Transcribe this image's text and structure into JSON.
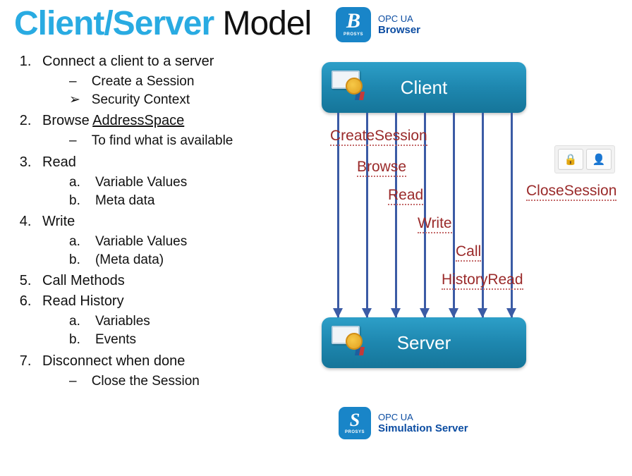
{
  "title": {
    "accent": "Client/Server",
    "plain": "Model"
  },
  "browser_logo": {
    "letter": "B",
    "prosys": "PROSYS",
    "line1": "OPC UA",
    "line2": "Browser"
  },
  "sim_logo": {
    "letter": "S",
    "prosys": "PROSYS",
    "line1": "OPC UA",
    "line2": "Simulation Server"
  },
  "outline": {
    "i1": {
      "text": "Connect a client to a server",
      "sub": [
        "Create a Session",
        "Security Context"
      ]
    },
    "i2": {
      "text_a": "Browse ",
      "text_b": "AddressSpace",
      "sub": [
        "To find what is available"
      ]
    },
    "i3": {
      "text": "Read",
      "sub": [
        "Variable Values",
        "Meta data"
      ]
    },
    "i4": {
      "text": "Write",
      "sub": [
        "Variable Values",
        "(Meta data)"
      ]
    },
    "i5": {
      "text": "Call Methods"
    },
    "i6": {
      "text": "Read History",
      "sub": [
        "Variables",
        "Events"
      ]
    },
    "i7": {
      "text": "Disconnect when done",
      "sub": [
        "Close the Session"
      ]
    }
  },
  "diagram": {
    "client_label": "Client",
    "server_label": "Server",
    "ops": [
      "CreateSession",
      "Browse",
      "Read",
      "Write",
      "Call",
      "HistoryRead"
    ],
    "close_label": "CloseSession"
  },
  "toolbar": {
    "lock_glyph": "🔒",
    "user_glyph": "👤"
  }
}
